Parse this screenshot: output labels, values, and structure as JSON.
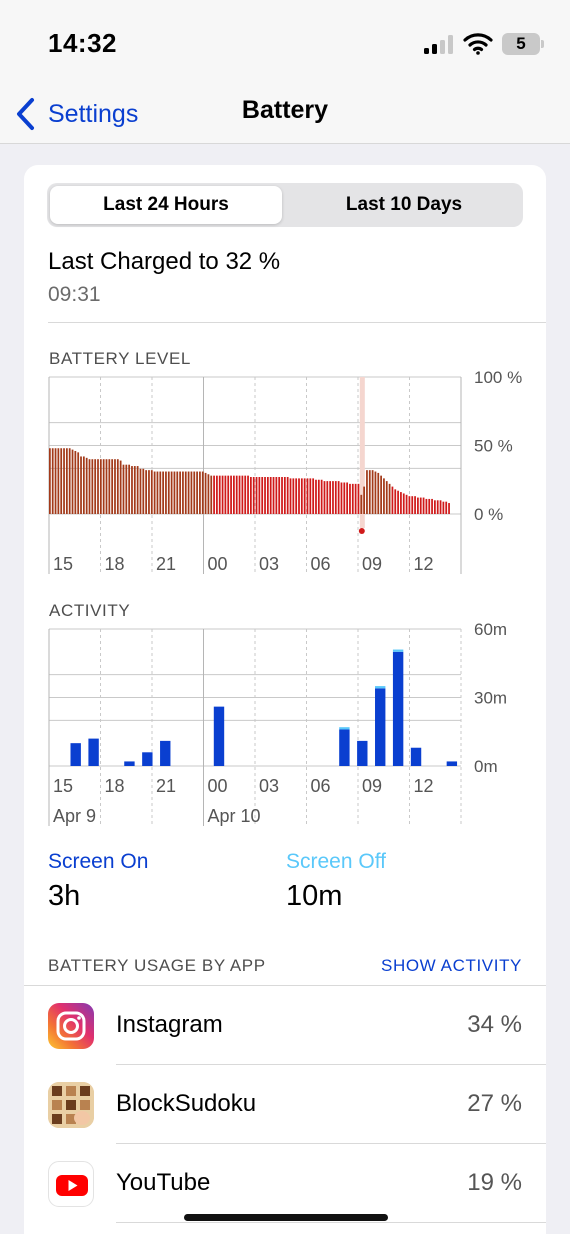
{
  "status": {
    "time": "14:32",
    "battery_level": "5"
  },
  "nav": {
    "back_label": "Settings",
    "title": "Battery"
  },
  "segmented": {
    "options": [
      "Last 24 Hours",
      "Last 10 Days"
    ],
    "selected": "Last 24 Hours"
  },
  "last_charged": {
    "label": "Last Charged to 32 %",
    "time": "09:31"
  },
  "colors": {
    "accent": "#0a3fd0",
    "screen_off": "#5ac8fa",
    "battery_fill": "#a33a1a",
    "low_power": "#d01a1a",
    "charging_band": "#f5d6cf"
  },
  "chart_data": [
    {
      "type": "bar",
      "title": "BATTERY LEVEL",
      "x_tick_labels": [
        "15",
        "18",
        "21",
        "00",
        "03",
        "06",
        "09",
        "12"
      ],
      "y_tick_labels": [
        "100 %",
        "50 %",
        "0 %"
      ],
      "ylim": [
        0,
        100
      ],
      "unit": "%",
      "series": [
        {
          "values": [
            48,
            48,
            48,
            48,
            48,
            48,
            48,
            48,
            47,
            46,
            45,
            42,
            42,
            41,
            40,
            40,
            40,
            40,
            40,
            40,
            40,
            40,
            40,
            40,
            40,
            39,
            36,
            36,
            36,
            35,
            35,
            35,
            33,
            33,
            32,
            32,
            32,
            31,
            31,
            31,
            31,
            31,
            31,
            31,
            31,
            31,
            31,
            31,
            31,
            31,
            31,
            31,
            31,
            31,
            31,
            30,
            29,
            28,
            28,
            28,
            28,
            28,
            28,
            28,
            28,
            28,
            28,
            28,
            28,
            28,
            28,
            27,
            27,
            27,
            27,
            27,
            27,
            27,
            27,
            27,
            27,
            27,
            27,
            27,
            27,
            26,
            26,
            26,
            26,
            26,
            26,
            26,
            26,
            26,
            25,
            25,
            25,
            24,
            24,
            24,
            24,
            24,
            24,
            23,
            23,
            23,
            22,
            22,
            22,
            22,
            14,
            20,
            32,
            32,
            32,
            31,
            30,
            28,
            26,
            24,
            22,
            20,
            18,
            17,
            16,
            15,
            14,
            13,
            13,
            13,
            12,
            12,
            12,
            11,
            11,
            11,
            10,
            10,
            10,
            9,
            9,
            8
          ],
          "low_power_from_index": 58
        }
      ],
      "charging_marker_at_index": 110
    },
    {
      "type": "bar",
      "title": "ACTIVITY",
      "x_tick_labels": [
        "15",
        "18",
        "21",
        "00",
        "03",
        "06",
        "09",
        "12"
      ],
      "date_labels": [
        "Apr 9",
        "Apr 10"
      ],
      "y_tick_labels": [
        "60m",
        "30m",
        "0m"
      ],
      "ylim": [
        0,
        60
      ],
      "unit": "minutes",
      "series": [
        {
          "name": "Screen On",
          "values": [
            0,
            10,
            12,
            0,
            2,
            6,
            11,
            0,
            0,
            26,
            0,
            0,
            0,
            0,
            0,
            0,
            16,
            11,
            34,
            50,
            8,
            0,
            2
          ]
        },
        {
          "name": "Screen Off",
          "values": [
            0,
            0,
            0,
            0,
            0,
            0,
            0,
            0,
            0,
            0,
            0,
            0,
            0,
            0,
            0,
            0,
            1,
            0,
            1,
            1,
            0,
            0,
            0
          ]
        }
      ]
    }
  ],
  "screen": {
    "on_label": "Screen On",
    "on_value": "3h",
    "off_label": "Screen Off",
    "off_value": "10m"
  },
  "usage": {
    "header": "BATTERY USAGE BY APP",
    "show_activity": "SHOW ACTIVITY",
    "apps": [
      {
        "name": "Instagram",
        "percent": "34 %",
        "icon": "instagram-icon"
      },
      {
        "name": "BlockSudoku",
        "percent": "27 %",
        "icon": "blocksudoku-icon"
      },
      {
        "name": "YouTube",
        "percent": "19 %",
        "icon": "youtube-icon"
      }
    ]
  }
}
